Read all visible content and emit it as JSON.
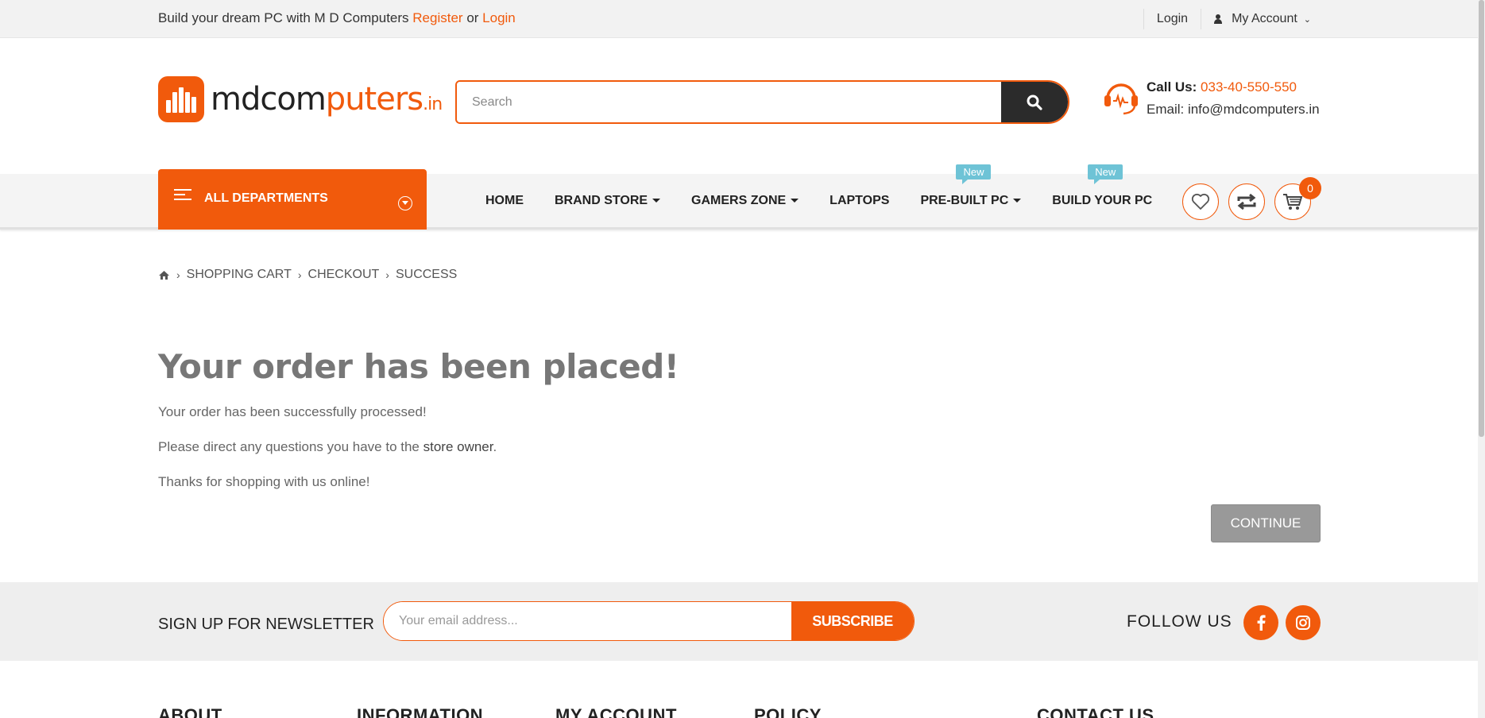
{
  "topbar": {
    "welcome_text": "Build your dream PC with M D Computers ",
    "register_label": "Register",
    "or_text": " or ",
    "login_link_label": "Login",
    "login_label": "Login",
    "account_label": "My Account"
  },
  "header": {
    "logo": {
      "part1": "mdcom",
      "part2": "puters",
      "tld": ".in"
    },
    "search": {
      "placeholder": "Search"
    },
    "contact": {
      "call_label": "Call Us:",
      "phone": "033-40-550-550",
      "email_label": "Email: info@mdcomputers.in"
    }
  },
  "nav": {
    "all_departments": "ALL DEPARTMENTS",
    "items": [
      {
        "label": "HOME"
      },
      {
        "label": "BRAND STORE"
      },
      {
        "label": "GAMERS ZONE"
      },
      {
        "label": "LAPTOPS"
      },
      {
        "label": "PRE-BUILT PC",
        "badge": "New"
      },
      {
        "label": "BUILD YOUR PC",
        "badge": "New"
      }
    ],
    "cart_count": "0"
  },
  "breadcrumb": [
    "SHOPPING CART",
    "CHECKOUT",
    "SUCCESS"
  ],
  "content": {
    "title": "Your order has been placed!",
    "line1": "Your order has been successfully processed!",
    "line2_prefix": "Please direct any questions you have to the ",
    "line2_link": "store owner",
    "line2_suffix": ".",
    "line3": "Thanks for shopping with us online!",
    "continue_label": "CONTINUE"
  },
  "newsletter": {
    "title": "SIGN UP FOR NEWSLETTER",
    "placeholder": "Your email address...",
    "subscribe_label": "SUBSCRIBE",
    "follow_label": "FOLLOW US"
  },
  "footer": {
    "headings": [
      "ABOUT",
      "INFORMATION",
      "MY ACCOUNT",
      "POLICY",
      "CONTACT US"
    ]
  },
  "colors": {
    "accent": "#f15a0c",
    "badge": "#6ec3d6",
    "dark": "#2b2b2b"
  }
}
